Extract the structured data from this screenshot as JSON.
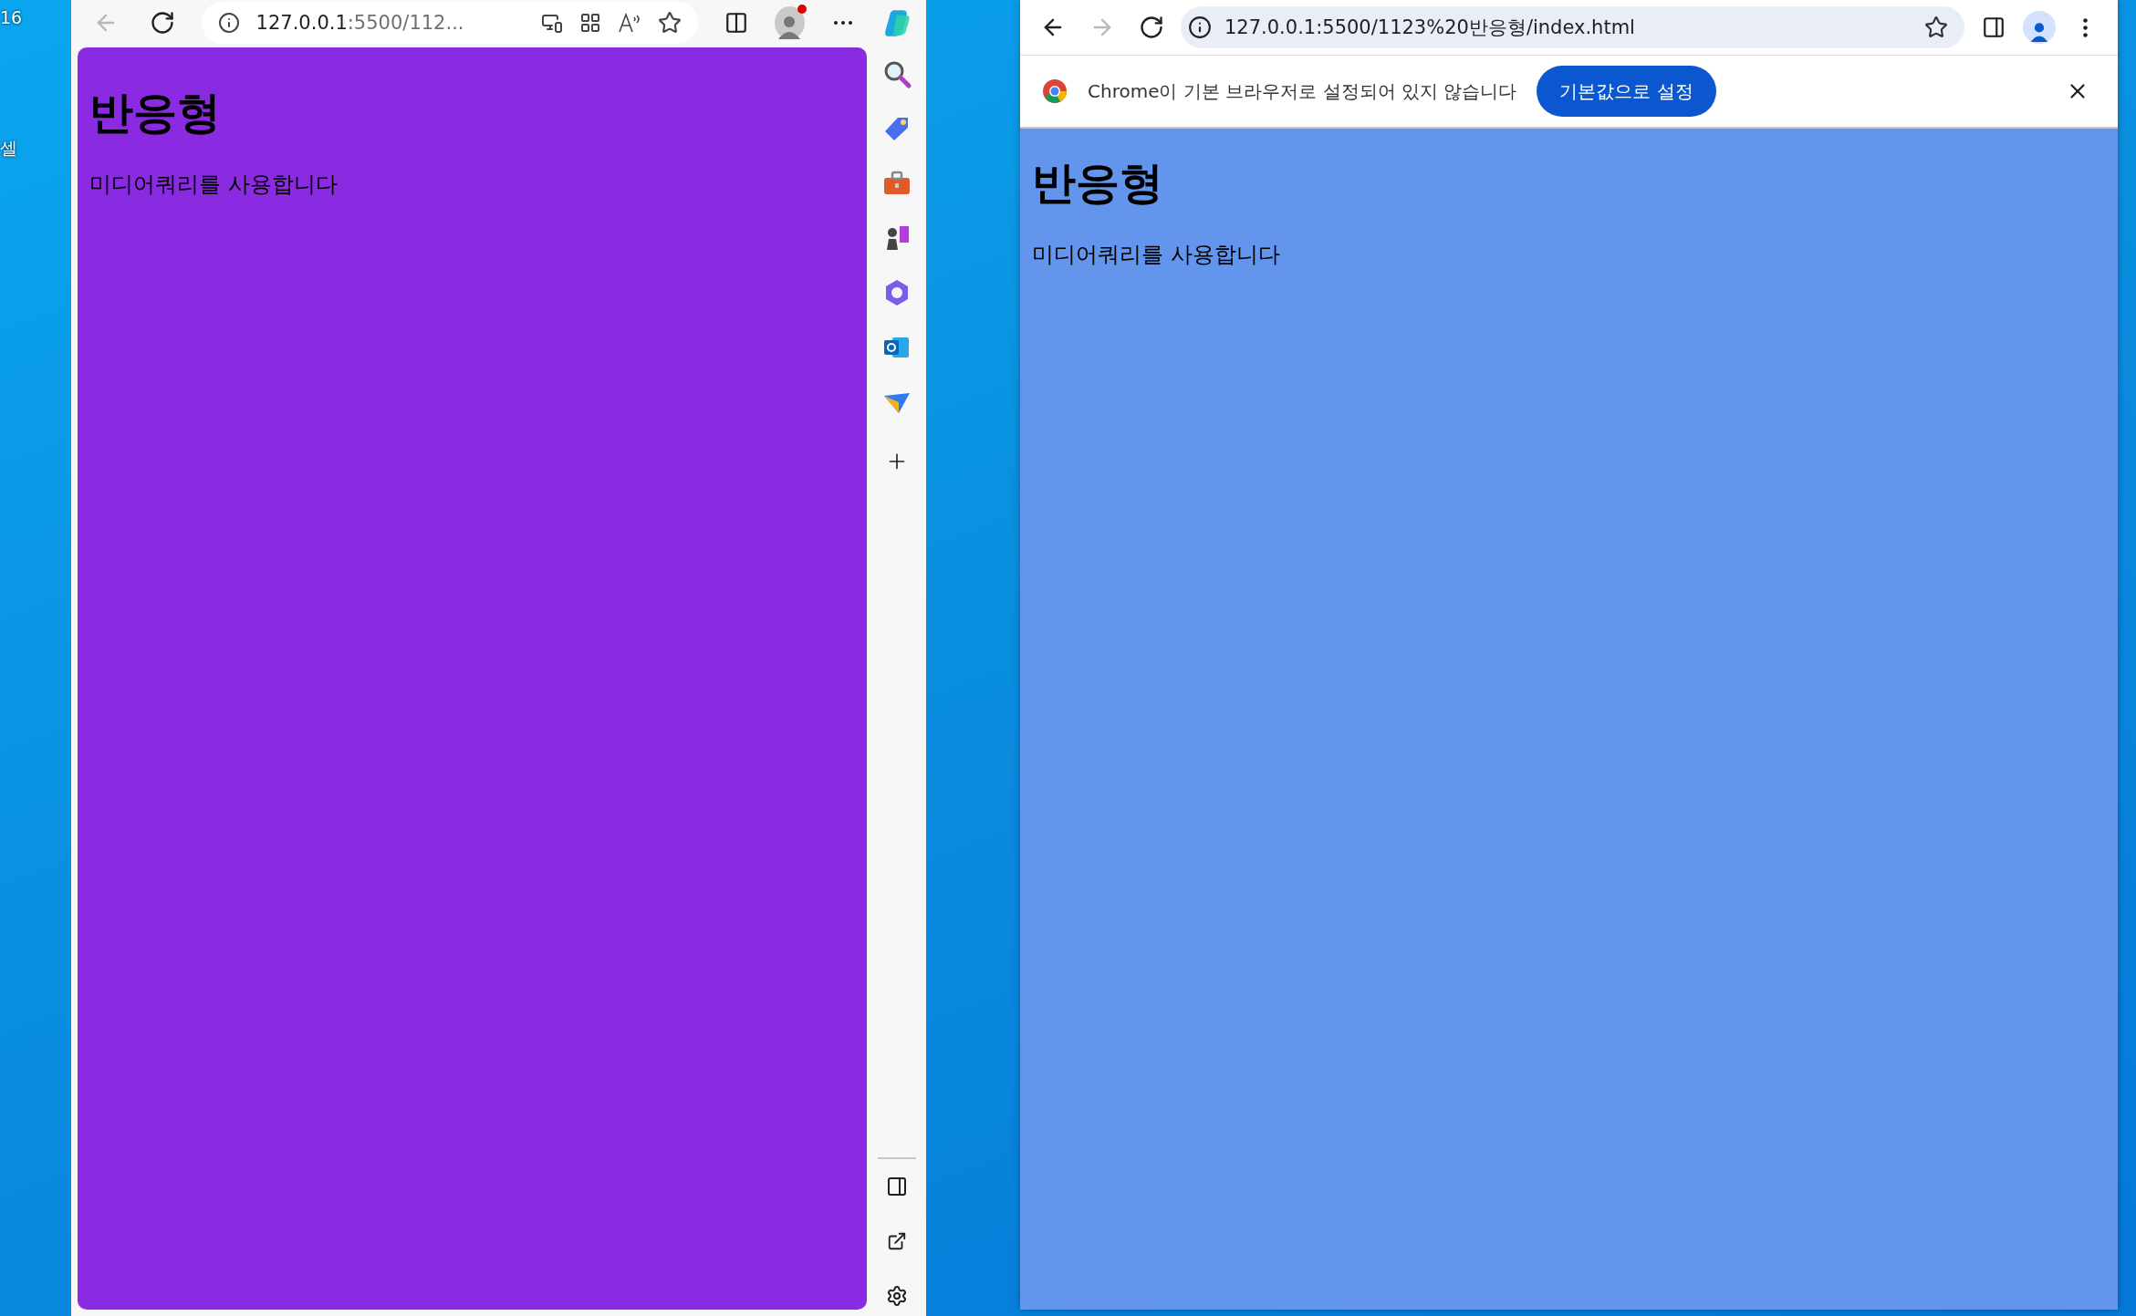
{
  "desktop": {
    "labels": [
      "16",
      "셀"
    ]
  },
  "edge": {
    "nav": [
      {
        "kind": "back",
        "disabled": true
      },
      {
        "kind": "reload",
        "disabled": false
      }
    ],
    "address": {
      "host": "127.0.0.1",
      "rest": ":5500/112..."
    },
    "profile": {
      "notification": true
    },
    "page": {
      "heading": "반응형",
      "text": "미디어쿼리를 사용합니다"
    }
  },
  "chrome": {
    "nav": [
      {
        "kind": "back",
        "disabled": false
      },
      {
        "kind": "forward",
        "disabled": true
      },
      {
        "kind": "reload",
        "disabled": false
      }
    ],
    "address": "127.0.0.1:5500/1123%20반응형/index.html",
    "infobar": {
      "message": "Chrome이 기본 브라우저로 설정되어 있지 않습니다",
      "button": "기본값으로 설정"
    },
    "page": {
      "heading": "반응형",
      "text": "미디어쿼리를 사용합니다"
    }
  }
}
